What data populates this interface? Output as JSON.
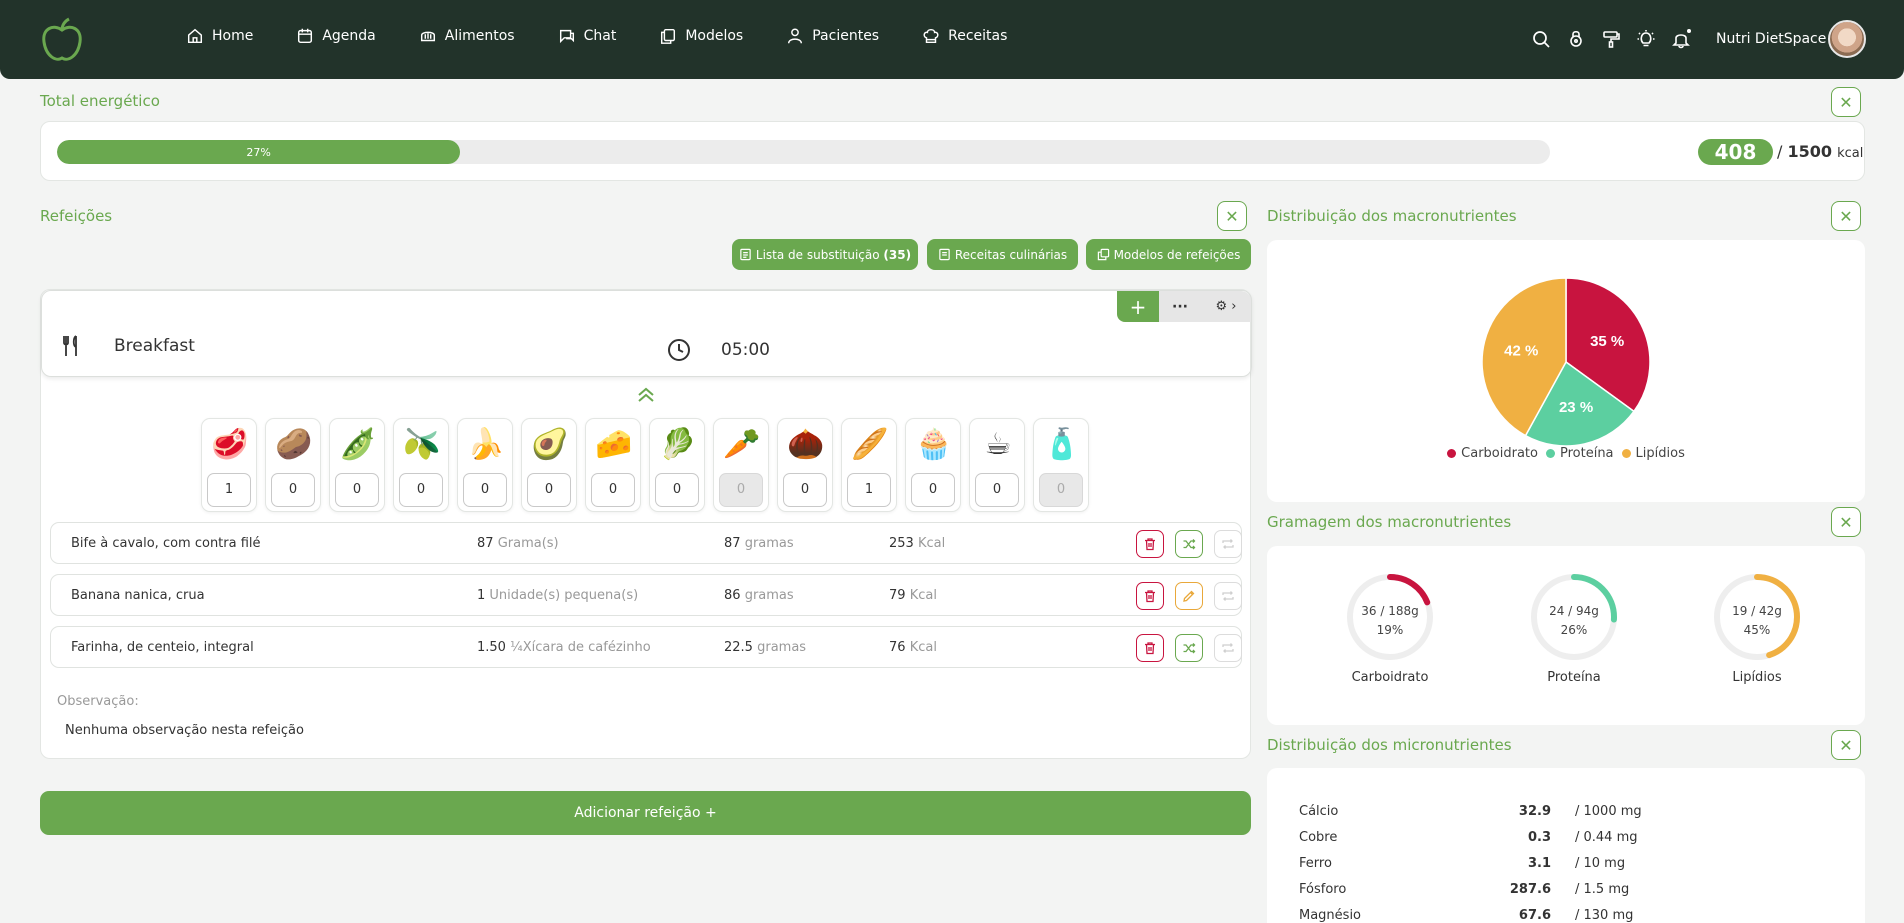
{
  "nav": {
    "items": [
      {
        "label": "Home",
        "icon": "home-icon"
      },
      {
        "label": "Agenda",
        "icon": "calendar-icon"
      },
      {
        "label": "Alimentos",
        "icon": "bread-icon"
      },
      {
        "label": "Chat",
        "icon": "chat-icon"
      },
      {
        "label": "Modelos",
        "icon": "copy-icon"
      },
      {
        "label": "Pacientes",
        "icon": "user-icon"
      },
      {
        "label": "Receitas",
        "icon": "chef-hat-icon"
      }
    ],
    "username": "Nutri DietSpace"
  },
  "colors": {
    "brand": "#6aa84f",
    "header": "#22332a",
    "carb": "#c8143f",
    "protein": "#5ccfa0",
    "lipid": "#f0b042"
  },
  "energy": {
    "title": "Total energético",
    "percent_label": "27%",
    "progress": 0.27,
    "current": "408",
    "separator": "/",
    "total": "1500",
    "unit": "kcal"
  },
  "meals_section": {
    "title": "Refeições",
    "buttons": {
      "substitution": "Lista de substituição",
      "substitution_count": "(35)",
      "recipes": "Receitas culinárias",
      "models": "Modelos de refeições"
    }
  },
  "meal": {
    "name": "Breakfast",
    "time": "05:00",
    "food_groups": [
      {
        "icon": "🥩",
        "name": "meat-icon",
        "qty": "1",
        "disabled": false
      },
      {
        "icon": "🥔",
        "name": "potato-icon",
        "qty": "0",
        "disabled": false
      },
      {
        "icon": "🫛",
        "name": "peas-icon",
        "qty": "0",
        "disabled": false
      },
      {
        "icon": "🫒",
        "name": "oil-icon",
        "qty": "0",
        "disabled": false
      },
      {
        "icon": "🍌",
        "name": "banana-icon",
        "qty": "0",
        "disabled": false
      },
      {
        "icon": "🥑",
        "name": "avocado-icon",
        "qty": "0",
        "disabled": false
      },
      {
        "icon": "🧀",
        "name": "cheese-icon",
        "qty": "0",
        "disabled": false
      },
      {
        "icon": "🥬",
        "name": "lettuce-icon",
        "qty": "0",
        "disabled": false
      },
      {
        "icon": "🥕",
        "name": "carrot-icon",
        "qty": "0",
        "disabled": true
      },
      {
        "icon": "🌰",
        "name": "nut-icon",
        "qty": "0",
        "disabled": false
      },
      {
        "icon": "🥖",
        "name": "bread-icon",
        "qty": "1",
        "disabled": false
      },
      {
        "icon": "🧁",
        "name": "cupcake-icon",
        "qty": "0",
        "disabled": false
      },
      {
        "icon": "☕",
        "name": "tea-icon",
        "qty": "0",
        "disabled": false
      },
      {
        "icon": "🧴",
        "name": "supplement-icon",
        "qty": "0",
        "disabled": true
      }
    ],
    "foods": [
      {
        "name": "Bife à cavalo, com contra filé",
        "qty": "87",
        "qty_unit": "Grama(s)",
        "grams": "87",
        "grams_unit": "gramas",
        "kcal": "253",
        "kcal_unit": "Kcal",
        "action": "substitute"
      },
      {
        "name": "Banana nanica, crua",
        "qty": "1",
        "qty_unit": "Unidade(s) pequena(s)",
        "grams": "86",
        "grams_unit": "gramas",
        "kcal": "79",
        "kcal_unit": "Kcal",
        "action": "edit"
      },
      {
        "name": "Farinha, de centeio, integral",
        "qty": "1.50",
        "qty_unit": "¼Xícara de cafézinho",
        "grams": "22.5",
        "grams_unit": "gramas",
        "kcal": "76",
        "kcal_unit": "Kcal",
        "action": "substitute"
      }
    ],
    "observation_label": "Observação:",
    "observation_text": "Nenhuma observação nesta refeição"
  },
  "add_meal_label": "Adicionar refeição +",
  "macro_distribution": {
    "title": "Distribuição dos macronutrientes",
    "chart_data": {
      "type": "pie",
      "slices": [
        {
          "name": "Carboidrato",
          "value": 35,
          "label": "35 %",
          "color": "#c8143f"
        },
        {
          "name": "Proteína",
          "value": 23,
          "label": "23 %",
          "color": "#5ccfa0"
        },
        {
          "name": "Lipídios",
          "value": 42,
          "label": "42 %",
          "color": "#f0b042"
        }
      ]
    }
  },
  "macro_grams": {
    "title": "Gramagem dos macronutrientes",
    "items": [
      {
        "name": "Carboidrato",
        "amount": "36 / 188g",
        "percent": "19%",
        "fraction": 0.19,
        "color": "#c8143f"
      },
      {
        "name": "Proteína",
        "amount": "24 / 94g",
        "percent": "26%",
        "fraction": 0.26,
        "color": "#5ccfa0"
      },
      {
        "name": "Lipídios",
        "amount": "19 / 42g",
        "percent": "45%",
        "fraction": 0.45,
        "color": "#f0b042"
      }
    ]
  },
  "micro": {
    "title": "Distribuição dos micronutrientes",
    "items": [
      {
        "name": "Cálcio",
        "value": "32.9",
        "target": "/  1000 mg"
      },
      {
        "name": "Cobre",
        "value": "0.3",
        "target": "/  0.44 mg"
      },
      {
        "name": "Ferro",
        "value": "3.1",
        "target": "/  10 mg"
      },
      {
        "name": "Fósforo",
        "value": "287.6",
        "target": "/  1.5 mg"
      },
      {
        "name": "Magnésio",
        "value": "67.6",
        "target": "/  130 mg"
      }
    ]
  }
}
